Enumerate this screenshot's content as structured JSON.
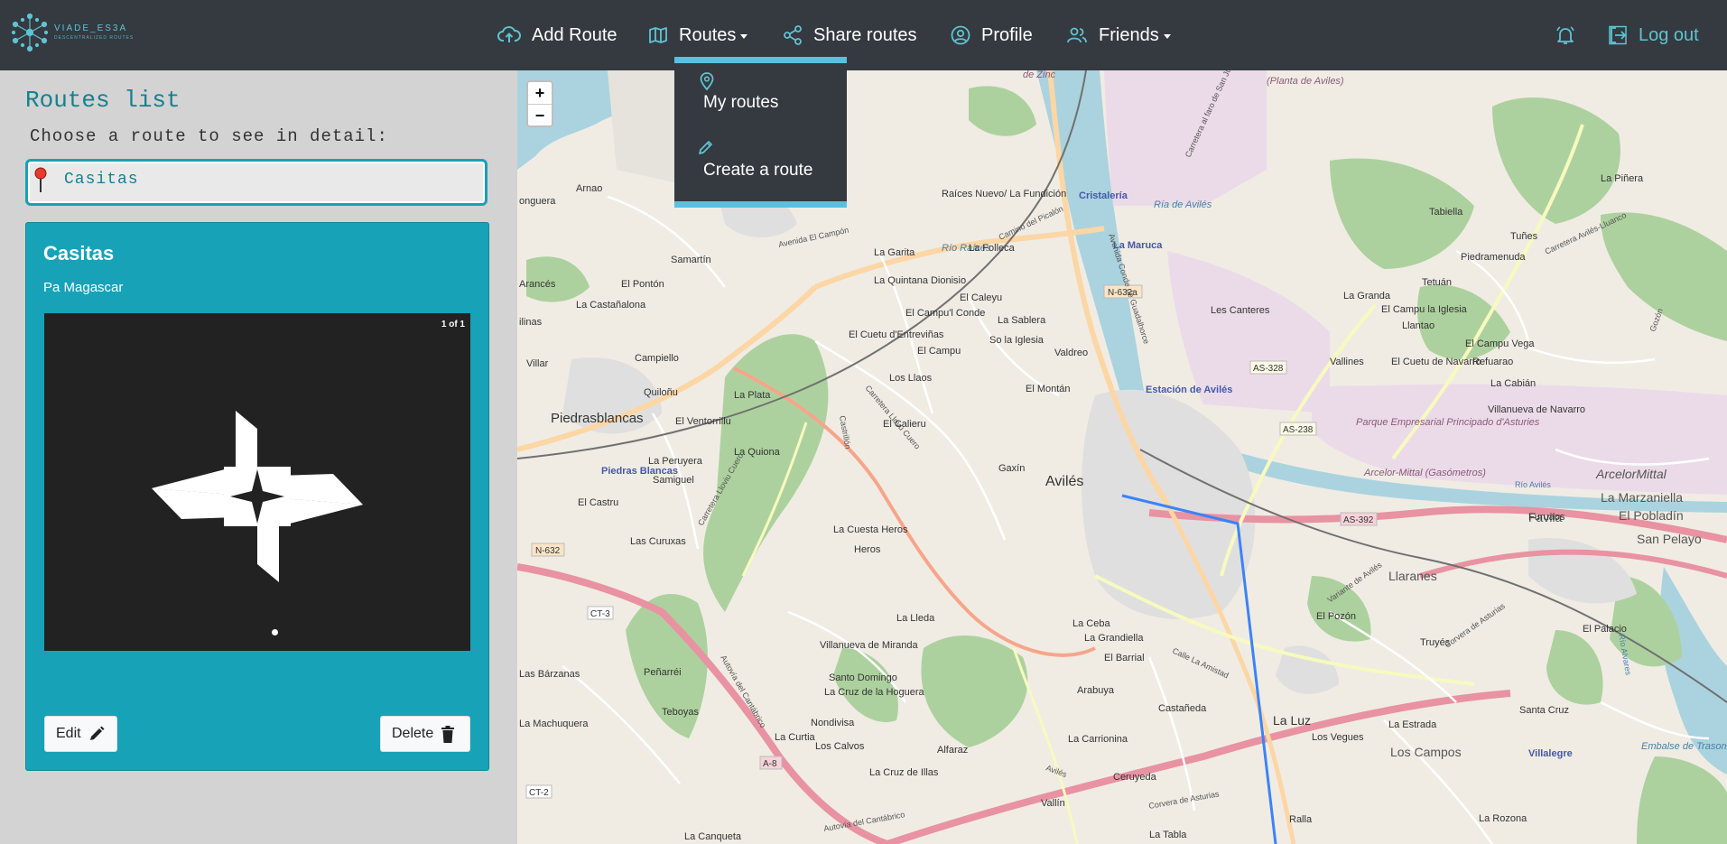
{
  "brand": {
    "name": "VIADE_ES3A",
    "tagline": "DESCENTRALIZED ROUTES"
  },
  "nav": {
    "add_route": "Add Route",
    "routes": "Routes",
    "share_routes": "Share routes",
    "profile": "Profile",
    "friends": "Friends",
    "logout": "Log out"
  },
  "routes_menu": {
    "my_routes": "My routes",
    "create_route": "Create a route"
  },
  "sidebar": {
    "title": "Routes list",
    "subtitle": "Choose a route to see in detail:",
    "selected_route": "Casitas"
  },
  "card": {
    "title": "Casitas",
    "description": "Pa Magascar",
    "image_counter": "1 of 1",
    "edit_label": "Edit",
    "delete_label": "Delete"
  },
  "map": {
    "zoom_in": "+",
    "zoom_out": "−",
    "labels": {
      "aviles": "Avilés",
      "piedrasblancas": "Piedrasblancas",
      "piedras_blancas": "Piedras Blancas",
      "llaranes": "Llaranes",
      "el_pobladin": "El Pobladín",
      "favila": "Favila",
      "arcelormittal": "ArcelorMittal",
      "la_marzaniella": "La Marzaniella",
      "san_pelayo": "San Pelayo",
      "cristaleria": "Cristalería",
      "la_maruca": "La Maruca",
      "estacion": "Estación de Avilés",
      "ria_aviles": "Ría de Avilés",
      "rio_raices": "Río Raíces",
      "la_luz": "La Luz",
      "los_campos": "Los Campos",
      "villalegre": "Villalegre",
      "el_pozon": "El Pozón",
      "la_lleda": "La Lleda",
      "la_ceba": "La Ceba",
      "la_grandiella": "La Grandiella",
      "el_barrial": "El Barrial",
      "arabuya": "Arabuya",
      "castaneda": "Castañeda",
      "la_carrionina": "La Carrionina",
      "ceruyeda": "Ceruyeda",
      "vallin": "Vallín",
      "ralla": "Ralla",
      "la_tabla": "La Tabla",
      "la_rozona": "La Rozona",
      "los_vegues": "Los Vegues",
      "la_estrada": "La Estrada",
      "santa_cruz": "Santa Cruz",
      "truyes": "Truyés",
      "el_palacio": "El Palacio",
      "embalse": "Embalse de Trasona / Trasona",
      "gaxin": "Gaxín",
      "heros": "Heros",
      "la_cuesta_heros": "La Cuesta Heros",
      "el_calieru": "El Calieru",
      "los_llaos": "Los Llaos",
      "el_montan": "El Montán",
      "valdreo": "Valdreo",
      "sola_iglesia": "So la Iglesia",
      "la_sablera": "La Sablera",
      "el_caleyu": "El Caleyu",
      "el_campu": "El Campu",
      "el_campul_conde": "El Campu'l Conde",
      "el_cuetu": "El Cuetu d'Entreviñas",
      "la_quintana": "La Quintana Dionisio",
      "la_garita": "La Garita",
      "la_folleca": "La Folleca",
      "raices_nuevo": "Raíces Nuevo/ La Fundición",
      "samartin": "Samartín",
      "arnao": "Arnao",
      "el_ponton": "El Pontón",
      "arances": "Arancés",
      "la_castanalona": "La Castañalona",
      "campiello": "Campiello",
      "villar": "Villar",
      "quilonu": "Quiloñu",
      "la_plata": "La Plata",
      "el_ventorrillu": "El Ventorrillu",
      "la_quiona": "La Quiona",
      "la_peruyera": "La Peruyera",
      "samiguel": "Samiguel",
      "el_castru": "El Castru",
      "las_curuxas": "Las Curuxas",
      "villanueva_miranda": "Villanueva de Miranda",
      "santo_domingo": "Santo Domingo",
      "la_cruz_hoguera": "La Cruz de la Hoguera",
      "nondivisa": "Nondivisa",
      "los_calvos": "Los Calvos",
      "alfaraz": "Alfaraz",
      "la_cruz_illas": "La Cruz de Illas",
      "la_curtia": "La Curtia",
      "penarrei": "Peñarréi",
      "teboyas": "Teboyas",
      "las_barzanas": "Las Bárzanas",
      "la_machuquera": "La Machuquera",
      "la_canqueta": "La Canqueta",
      "tabiella": "Tabiella",
      "tunes": "Tuñes",
      "la_pinera": "La Piñera",
      "piedramenuda": "Piedramenuda",
      "tetuan": "Tetuán",
      "la_granda": "La Granda",
      "el_campu_iglesia": "El Campu la Iglesia",
      "llantao": "Llantao",
      "les_canteres": "Les Canteres",
      "vallines": "Vallines",
      "el_cuetu_navarro": "El Cuetu de Navarro",
      "el_campu_vega": "El Campu Vega",
      "refuarao": "Refuarao",
      "la_cabian": "La Cabián",
      "villanueva_navarro": "Villanueva de Navarro",
      "parque": "Parque Empresarial Principado d'Asturies",
      "arcelor_gas": "Arcelor-Mittal (Gasómetros)",
      "el_pobladin_2": "Furuaos",
      "planta_zinc": "(Planta de Aviles)",
      "de_zinc": "de Zinc",
      "onguera": "onguera",
      "ilinas": "ilinas"
    },
    "roads": {
      "n632": "N-632",
      "n632a": "N-632a",
      "as328": "AS-328",
      "as238": "AS-238",
      "as392": "AS-392",
      "ct3": "CT-3",
      "ct2": "CT-2",
      "a8": "A-8",
      "av_campon": "Avenida El Campón",
      "av_conde": "Avenida Conde de Guadalhorce",
      "camino_picalon": "Camino del Picalón",
      "carretera_lluvu": "Carretera Llovu Cuero",
      "carretera_lloviu": "Carretera Lloviu Cuero",
      "autovia": "Autovía del Cantábrico",
      "calle_amistad": "Calle La Amistad",
      "variante": "Variante de Avilés",
      "corvera": "Corvera de Asturias",
      "carretera_faro": "Carretera al faro de San Juan",
      "carretera_lluanco": "Carretera Avilés-Lluanco",
      "castrillon": "Castrillón",
      "aviles_road": "Avilés",
      "gozon": "Gozón",
      "rio_aviles": "Río Avilés",
      "rio_alvares": "Río Alvares"
    }
  }
}
